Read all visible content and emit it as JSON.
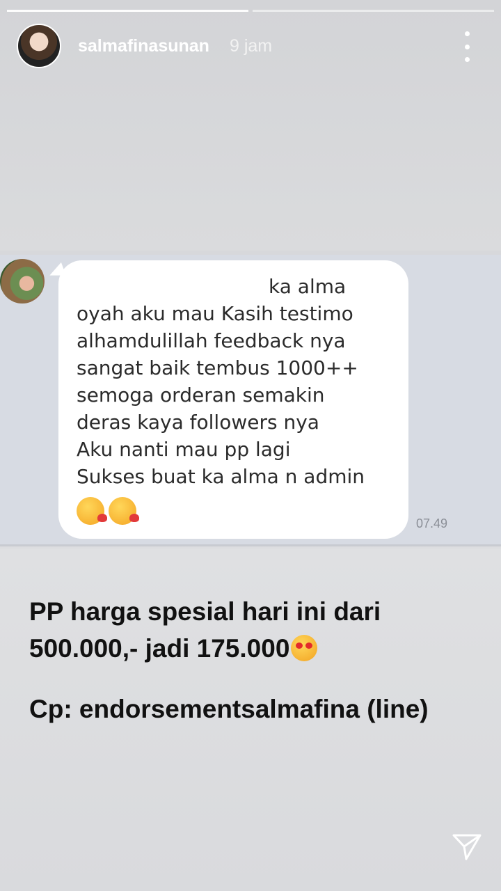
{
  "header": {
    "username": "salmafinasunan",
    "time_ago": "9 jam",
    "progress_segments": 2,
    "current_segment": 1
  },
  "chat": {
    "lines": [
      "ka alma",
      "oyah aku mau Kasih testimo",
      "alhamdulillah feedback nya",
      "sangat baik tembus 1000++",
      "semoga orderan semakin",
      "deras kaya followers nya",
      "Aku nanti mau pp lagi",
      "Sukses buat ka alma n admin"
    ],
    "emojis": [
      "kissing-heart-emoji",
      "kissing-heart-emoji"
    ],
    "time": "07.49"
  },
  "caption": {
    "line1": "PP harga spesial hari ini dari",
    "line2": "500.000,- jadi 175.000",
    "line2_emoji": "heart-eyes-emoji",
    "contact": "Cp: endorsementsalmafina (line)"
  },
  "icons": {
    "more": "more-vertical-icon",
    "send": "paper-plane-icon"
  }
}
